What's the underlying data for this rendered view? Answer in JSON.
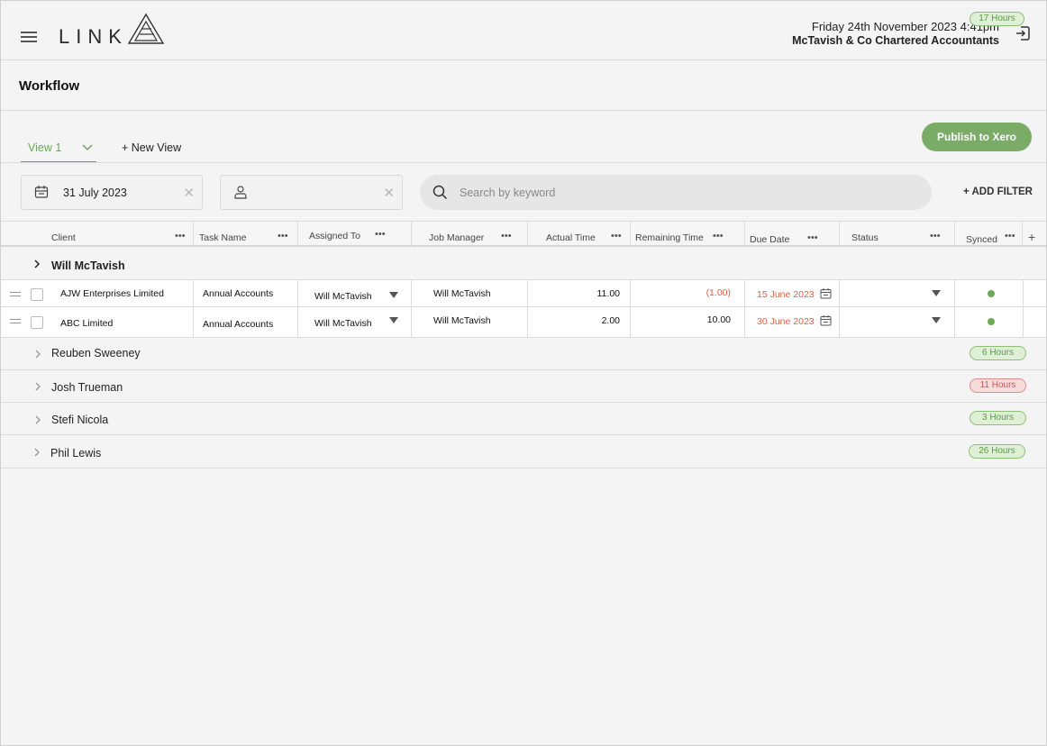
{
  "header": {
    "logo_text": "LINK",
    "datetime": "Friday 24th November 2023  4:41pm",
    "company": "McTavish & Co Chartered Accountants"
  },
  "page": {
    "title": "Workflow"
  },
  "tabs": {
    "view1": "View 1",
    "new_view": "+ New View"
  },
  "actions": {
    "publish": "Publish to Xero",
    "add_filter": "+ ADD FILTER"
  },
  "filters": {
    "date": "31 July 2023",
    "person": "",
    "search_placeholder": "Search by keyword"
  },
  "columns": [
    "Client",
    "Task Name",
    "Assigned To",
    "Job Manager",
    "Actual Time",
    "Remaining Time",
    "Due Date",
    "Status",
    "Synced"
  ],
  "groups": [
    {
      "name": "Will McTavish",
      "hours": "17 Hours",
      "status": "green",
      "expanded": true,
      "rows": [
        {
          "client": "AJW Enterprises Limited",
          "task": "Annual Accounts",
          "assigned": "Will McTavish",
          "manager": "Will McTavish",
          "actual": "11.00",
          "remaining": "(1.00)",
          "due": "15 June 2023",
          "status": "",
          "synced": true
        },
        {
          "client": "ABC Limited",
          "task": "Annual Accounts",
          "assigned": "Will McTavish",
          "manager": "Will McTavish",
          "actual": "2.00",
          "remaining": "10.00",
          "due": "30 June 2023",
          "status": "",
          "synced": true
        }
      ]
    },
    {
      "name": "Reuben Sweeney",
      "hours": "6 Hours",
      "status": "green"
    },
    {
      "name": "Josh Trueman",
      "hours": "11 Hours",
      "status": "red"
    },
    {
      "name": "Stefi Nicola",
      "hours": "3 Hours",
      "status": "green"
    },
    {
      "name": "Phil Lewis",
      "hours": "26 Hours",
      "status": "green"
    }
  ],
  "colors": {
    "accent": "#7aab67",
    "danger": "#d9614a"
  },
  "icons": [
    "menu-icon",
    "logout-icon",
    "calendar-icon",
    "user-icon",
    "search-icon",
    "chevron-down-icon",
    "chevron-right-icon",
    "more-icon",
    "plus-icon",
    "drag-handle-icon"
  ]
}
